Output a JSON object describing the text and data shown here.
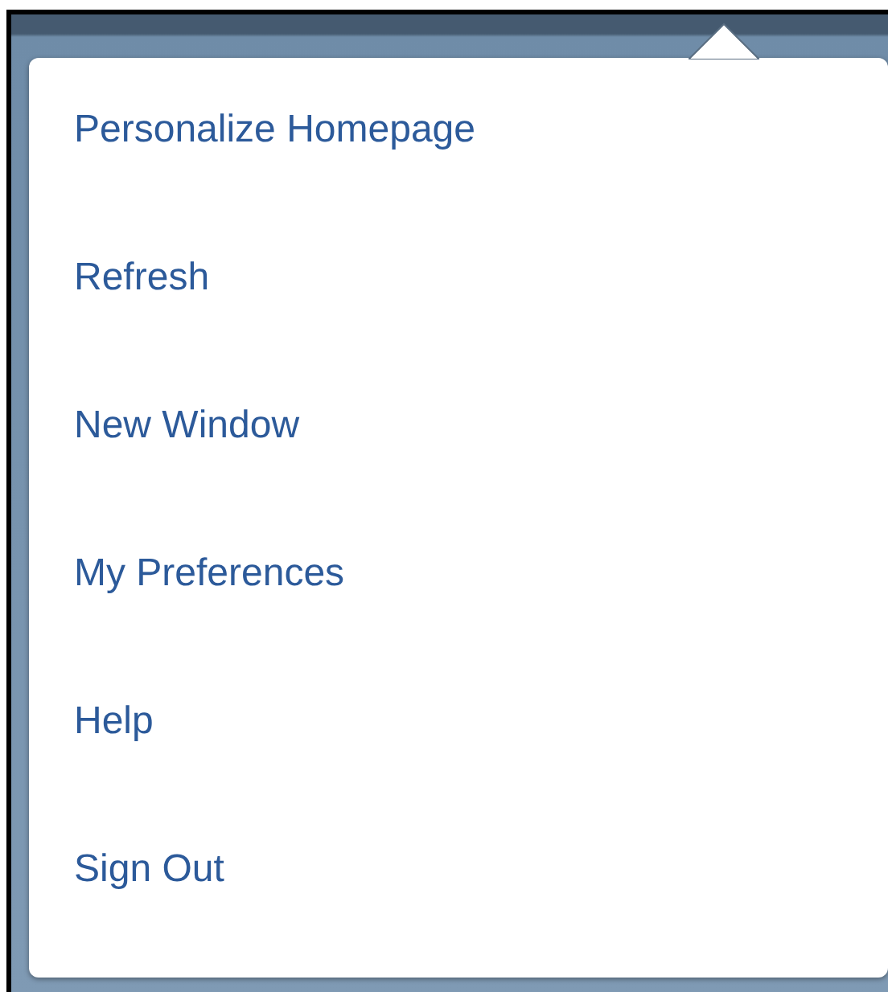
{
  "menu": {
    "items": [
      {
        "label": "Personalize Homepage"
      },
      {
        "label": "Refresh"
      },
      {
        "label": "New Window"
      },
      {
        "label": "My Preferences"
      },
      {
        "label": "Help"
      },
      {
        "label": "Sign Out"
      }
    ]
  }
}
